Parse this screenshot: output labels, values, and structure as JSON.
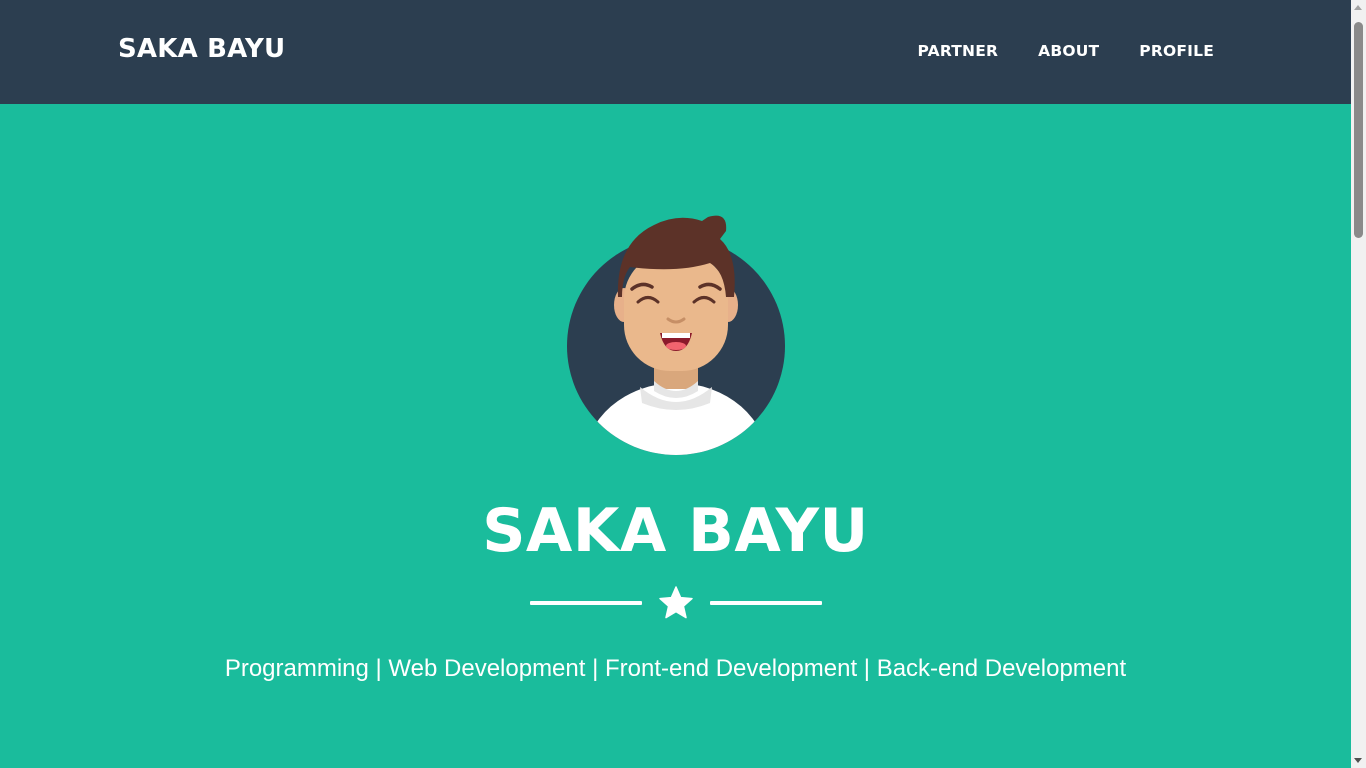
{
  "navbar": {
    "brand": "SAKA BAYU",
    "links": [
      "PARTNER",
      "ABOUT",
      "PROFILE"
    ]
  },
  "hero": {
    "title": "SAKA BAYU",
    "tagline": "Programming | Web Development | Front-end Development | Back-end Development"
  },
  "icons": {
    "avatar": "avatar-illustration",
    "divider": "star-icon"
  },
  "colors": {
    "navbar": "#2c3e50",
    "hero_background": "#1abc9c",
    "text": "#ffffff"
  }
}
